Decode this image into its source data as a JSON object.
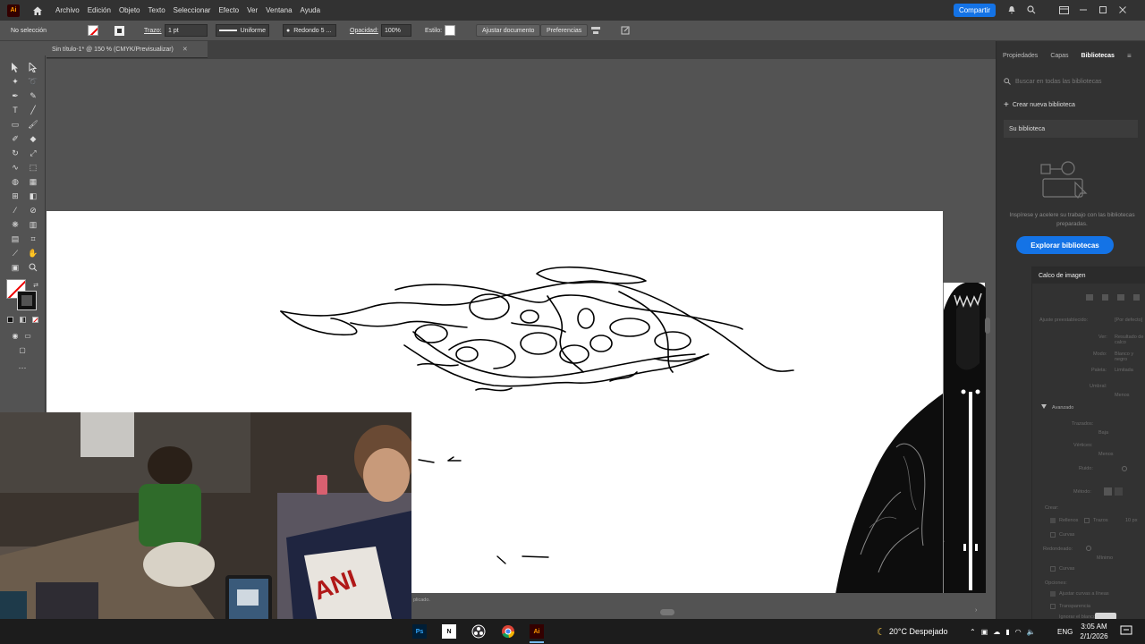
{
  "app": {
    "logo": "Ai",
    "menus": [
      "Archivo",
      "Edición",
      "Objeto",
      "Texto",
      "Seleccionar",
      "Efecto",
      "Ver",
      "Ventana",
      "Ayuda"
    ],
    "share_label": "Compartir"
  },
  "control_bar": {
    "selection": "No selección",
    "stroke_label": "Trazo:",
    "stroke_weight": "1 pt",
    "stroke_profile": "Uniforme",
    "brush": "Redondo 5 ...",
    "opacity_label": "Opacidad:",
    "opacity_value": "100%",
    "style_label": "Estilo:",
    "adjust_doc": "Ajustar documento",
    "preferences": "Preferencias"
  },
  "document": {
    "tab_title": "Sin título-1* @ 150 % (CMYK/Previsualizar)",
    "status_text": "plicado."
  },
  "right_panel": {
    "tabs": [
      "Propiedades",
      "Capas",
      "Bibliotecas"
    ],
    "active_tab": "Bibliotecas",
    "search_placeholder": "Buscar en todas las bibliotecas",
    "create_label": "Crear nueva biblioteca",
    "own_library": "Su biblioteca",
    "inspire_text": "Inspírese y acelere su trabajo con las bibliotecas preparadas.",
    "explore_button": "Explorar bibliotecas"
  },
  "trace_panel": {
    "title": "Calco de imagen",
    "rows": [
      {
        "label": "Ajuste preestablecido:",
        "value": "[Por defecto]"
      },
      {
        "label": "Ver:",
        "value": "Resultado de calco"
      },
      {
        "label": "Modo:",
        "value": "Blanco y negro"
      },
      {
        "label": "Paleta:",
        "value": "Limitada"
      },
      {
        "label": "Umbral:",
        "value": ""
      },
      {
        "label": "",
        "value": "Menos"
      }
    ],
    "advanced_label": "Avanzado",
    "advanced_rows": [
      {
        "label": "Trazados:",
        "value": ""
      },
      {
        "label": "",
        "value": "Baja"
      },
      {
        "label": "Vértices:",
        "value": ""
      },
      {
        "label": "",
        "value": "Menos"
      },
      {
        "label": "Ruido:",
        "value": ""
      },
      {
        "label": "Método:",
        "value": ""
      }
    ],
    "create_label": "Crear:",
    "fills_label": "Rellenos",
    "strokes_label": "Trazos",
    "strokes_value": "10 px",
    "curves_label": "Curvas",
    "straight_label": "Redondeado:",
    "straight_value": "Mínimo",
    "options_label": "Opciones:",
    "snap_label": "Ajustar curvas a líneas",
    "ignore_label": "Ignorar el blanco",
    "transparency_label": "Transparencia"
  },
  "taskbar": {
    "apps": [
      "Ps",
      "N",
      "OBS",
      "Chrome",
      "Ai"
    ],
    "weather": "20°C Despejado",
    "language": "ENG",
    "time": "3:05 AM",
    "date": "2/1/2026"
  },
  "colors": {
    "accent": "#1473e6",
    "menubar_bg": "#323232",
    "workspace_bg": "#535353",
    "panel_bg": "#323232",
    "taskbar_bg": "#1c1c1c"
  }
}
